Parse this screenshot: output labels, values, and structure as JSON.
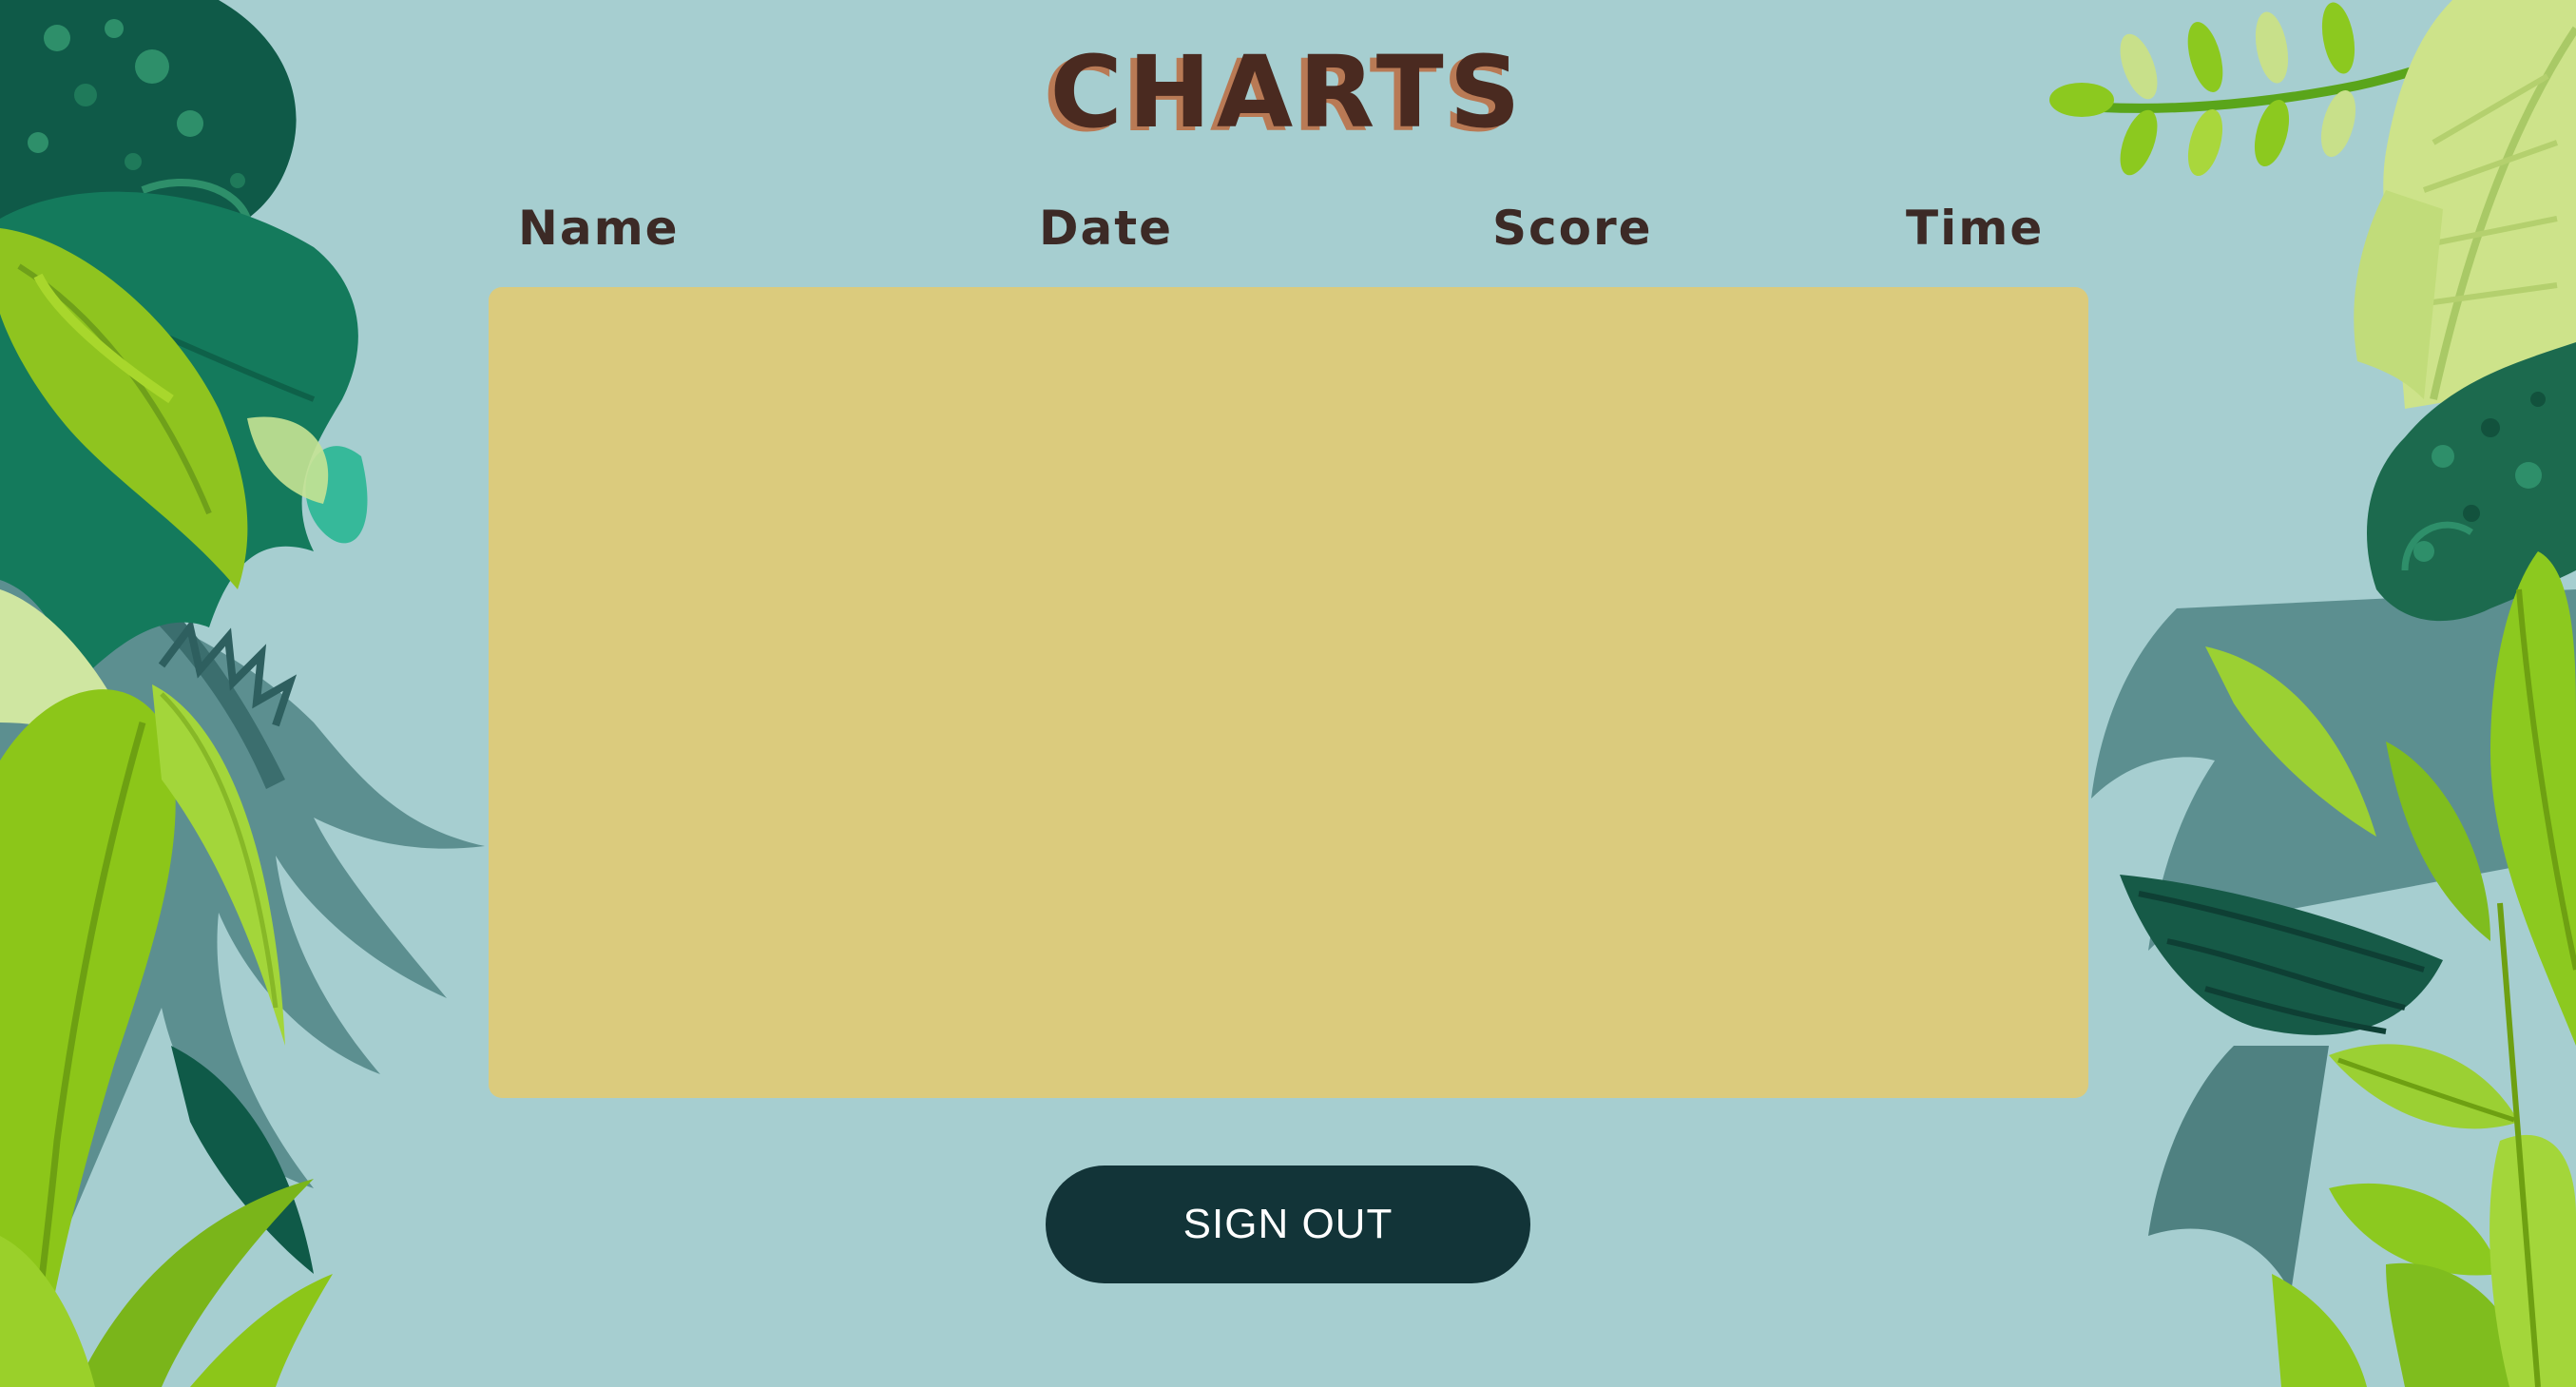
{
  "title": "CHARTS",
  "table": {
    "columns": [
      "Name",
      "Date",
      "Score",
      "Time"
    ],
    "rows": []
  },
  "sign_out_label": "SIGN OUT",
  "colors": {
    "background": "#a6ced0",
    "panel": "#dbcb7d",
    "button": "#123438",
    "title": "#4a2a20",
    "title_shadow": "#b97a55"
  }
}
